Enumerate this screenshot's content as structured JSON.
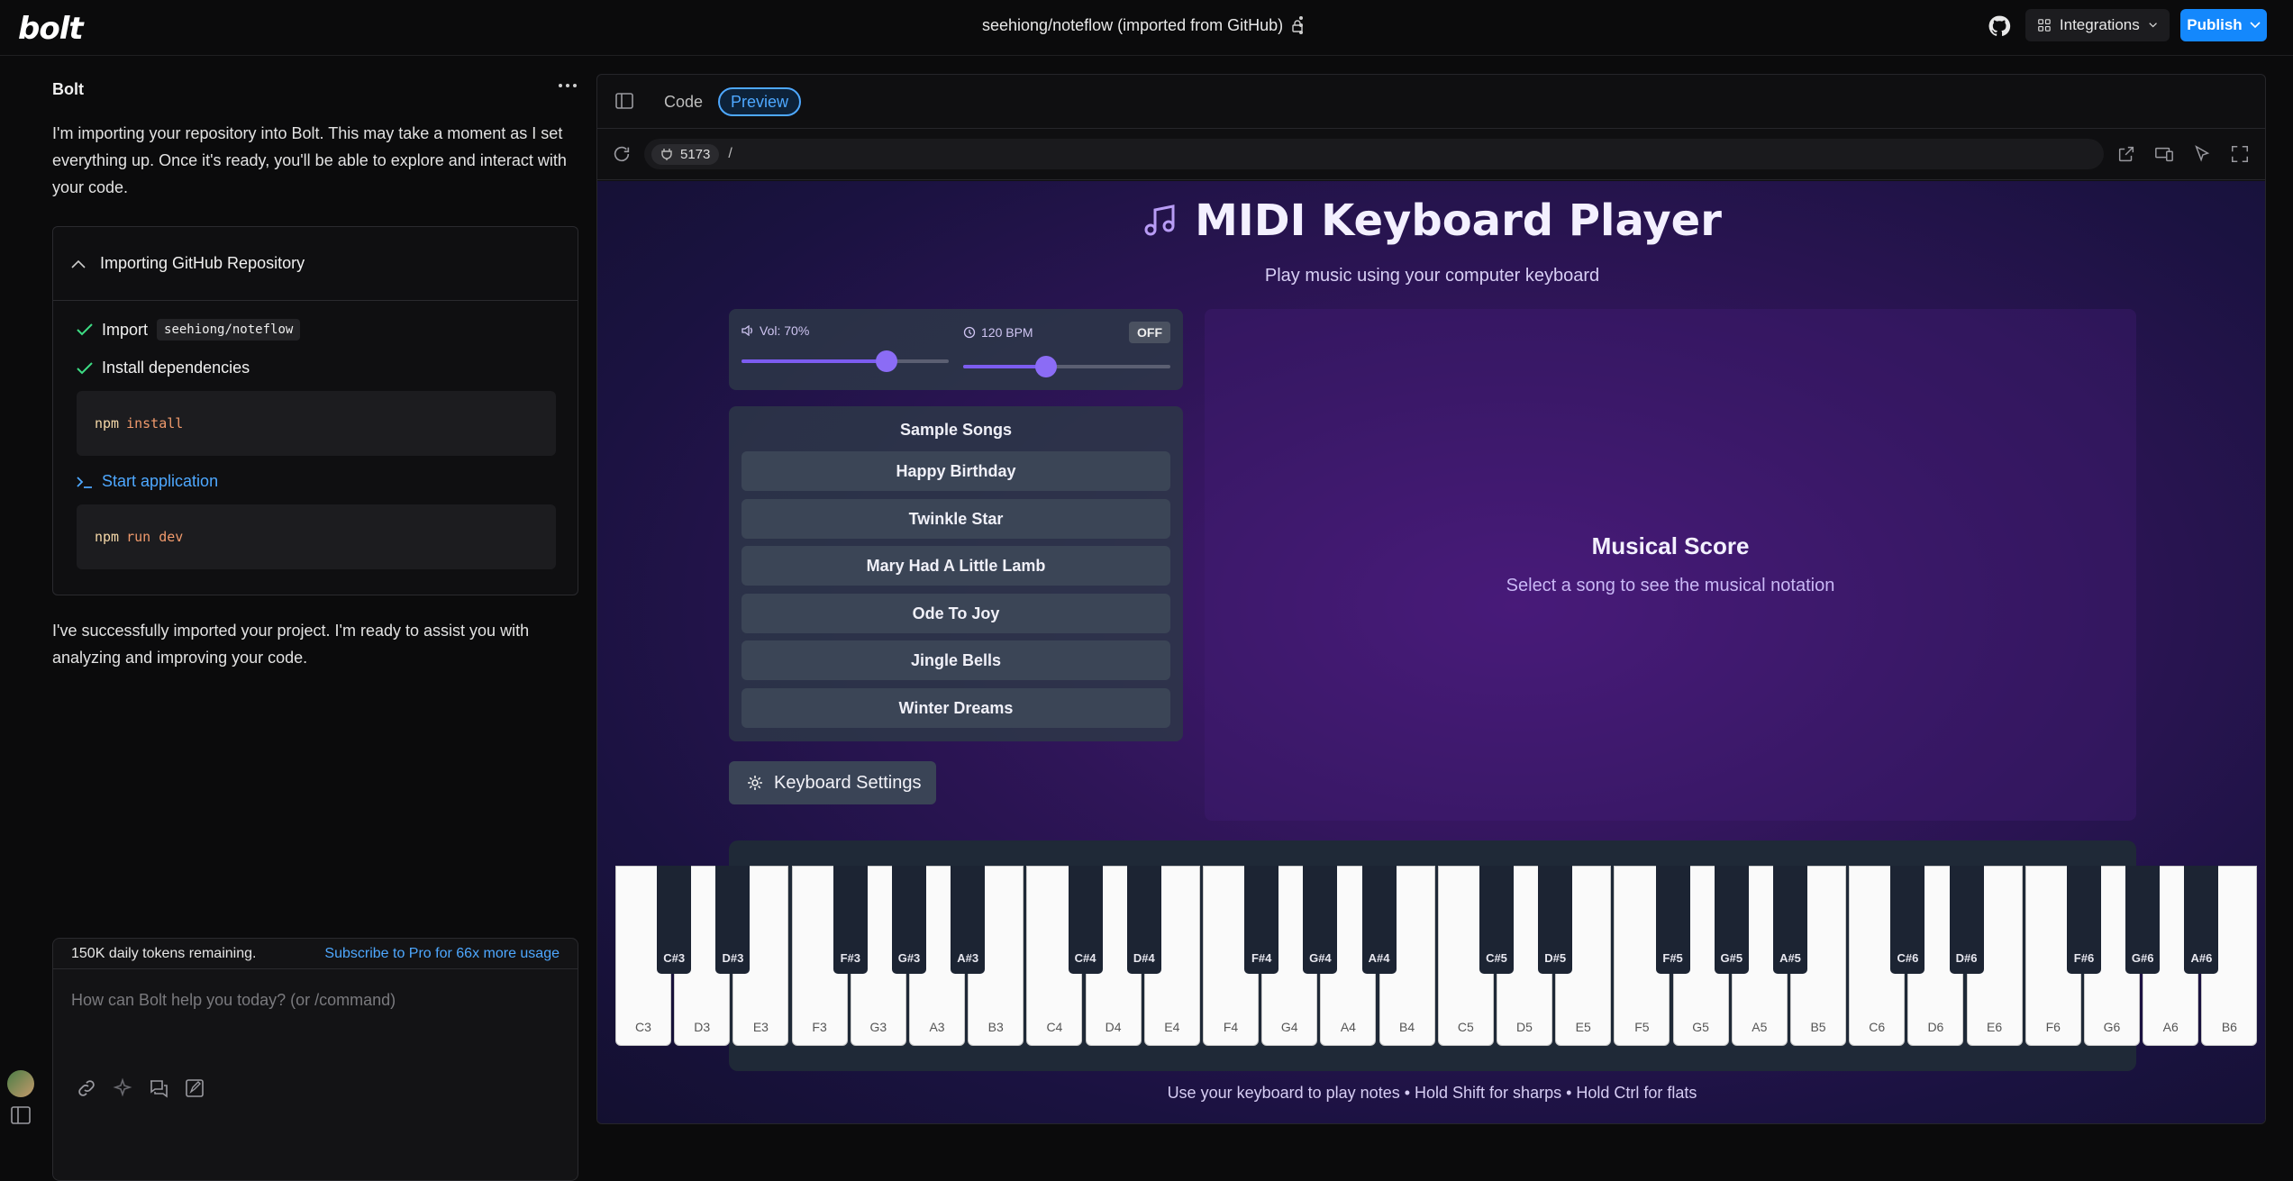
{
  "topbar": {
    "logo": "bolt",
    "project_title": "seehiong/noteflow (imported from GitHub)",
    "integrations_label": "Integrations",
    "publish_label": "Publish"
  },
  "chat": {
    "header": "Bolt",
    "intro": "I'm importing your repository into Bolt. This may take a moment as I set everything up. Once it's ready, you'll be able to explore and interact with your code.",
    "import_box": {
      "title": "Importing GitHub Repository",
      "step1_label": "Import",
      "step1_chip": "seehiong/noteflow",
      "step2_label": "Install dependencies",
      "cmd1_keyword": "npm",
      "cmd1_args": "install",
      "step3_label": "Start application",
      "cmd2_keyword": "npm",
      "cmd2_args": "run dev"
    },
    "done_msg": "I've successfully imported your project. I'm ready to assist you with analyzing and improving your code.",
    "tokens_remaining": "150K daily tokens remaining.",
    "subscribe_link": "Subscribe to Pro for 66x more usage",
    "input_placeholder": "How can Bolt help you today? (or /command)"
  },
  "workbench": {
    "tab_code": "Code",
    "tab_preview": "Preview",
    "port": "5173",
    "path": "/"
  },
  "app": {
    "title": "MIDI Keyboard Player",
    "subtitle": "Play music using your computer keyboard",
    "volume_label": "Vol: 70%",
    "volume_value": 0.7,
    "bpm_label": "120 BPM",
    "bpm_value": 0.4,
    "metronome_label": "OFF",
    "songs_title": "Sample Songs",
    "songs": [
      "Happy Birthday",
      "Twinkle Star",
      "Mary Had A Little Lamb",
      "Ode To Joy",
      "Jingle Bells",
      "Winter Dreams"
    ],
    "settings_label": "Keyboard Settings",
    "score_title": "Musical Score",
    "score_sub": "Select a song to see the musical notation",
    "white_keys": [
      "C3",
      "D3",
      "E3",
      "F3",
      "G3",
      "A3",
      "B3",
      "C4",
      "D4",
      "E4",
      "F4",
      "G4",
      "A4",
      "B4",
      "C5",
      "D5",
      "E5",
      "F5",
      "G5",
      "A5",
      "B5",
      "C6",
      "D6",
      "E6",
      "F6",
      "G6",
      "A6",
      "B6"
    ],
    "black_keys": [
      "C#3",
      "D#3",
      "F#3",
      "G#3",
      "A#3",
      "C#4",
      "D#4",
      "F#4",
      "G#4",
      "A#4",
      "C#5",
      "D#5",
      "F#5",
      "G#5",
      "A#5",
      "C#6",
      "D#6",
      "F#6",
      "G#6",
      "A#6"
    ],
    "footer_hint": "Use your keyboard to play notes • Hold Shift for sharps • Hold Ctrl for flats"
  }
}
